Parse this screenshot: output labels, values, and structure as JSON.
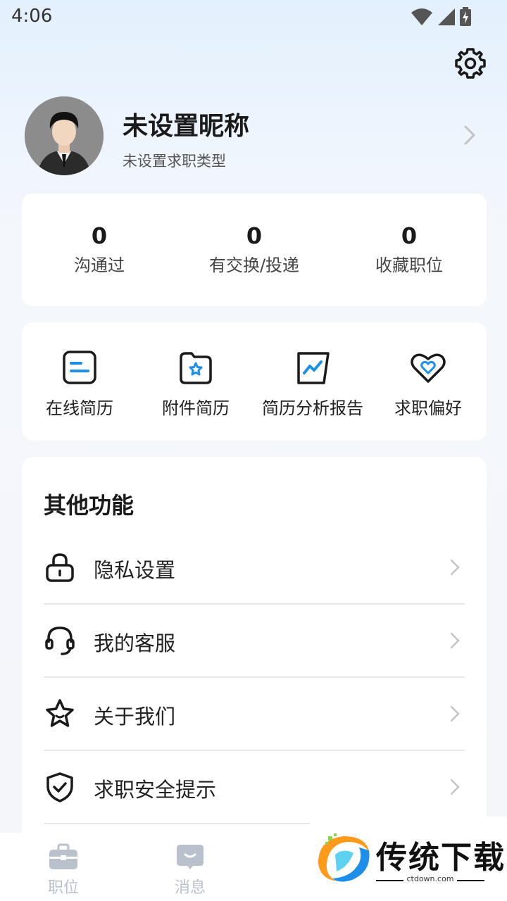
{
  "status_bar": {
    "time": "4:06",
    "icons": [
      "wifi-icon",
      "signal-icon",
      "battery-charging-icon"
    ]
  },
  "profile": {
    "nickname": "未设置昵称",
    "job_type": "未设置求职类型"
  },
  "stats": [
    {
      "value": "0",
      "label": "沟通过"
    },
    {
      "value": "0",
      "label": "有交换/投递"
    },
    {
      "value": "0",
      "label": "收藏职位"
    }
  ],
  "tools": [
    {
      "label": "在线简历",
      "icon": "online-resume-icon"
    },
    {
      "label": "附件简历",
      "icon": "attachment-resume-icon"
    },
    {
      "label": "简历分析报告",
      "icon": "resume-analysis-icon"
    },
    {
      "label": "求职偏好",
      "icon": "job-preference-heart-icon"
    }
  ],
  "other": {
    "title": "其他功能",
    "items": [
      {
        "label": "隐私设置",
        "icon": "lock-icon"
      },
      {
        "label": "我的客服",
        "icon": "headset-icon"
      },
      {
        "label": "关于我们",
        "icon": "star-icon"
      },
      {
        "label": "求职安全提示",
        "icon": "shield-check-icon"
      }
    ]
  },
  "tabbar": {
    "tabs": [
      {
        "label": "职位",
        "icon": "briefcase-icon"
      },
      {
        "label": "消息",
        "icon": "chat-icon"
      }
    ]
  },
  "watermark": {
    "brand": "传统下载",
    "url": "ctdown.com"
  },
  "colors": {
    "accent": "#1e8fe8",
    "tab_inactive": "#b9c1cc",
    "text_primary": "#1a1a1a"
  }
}
